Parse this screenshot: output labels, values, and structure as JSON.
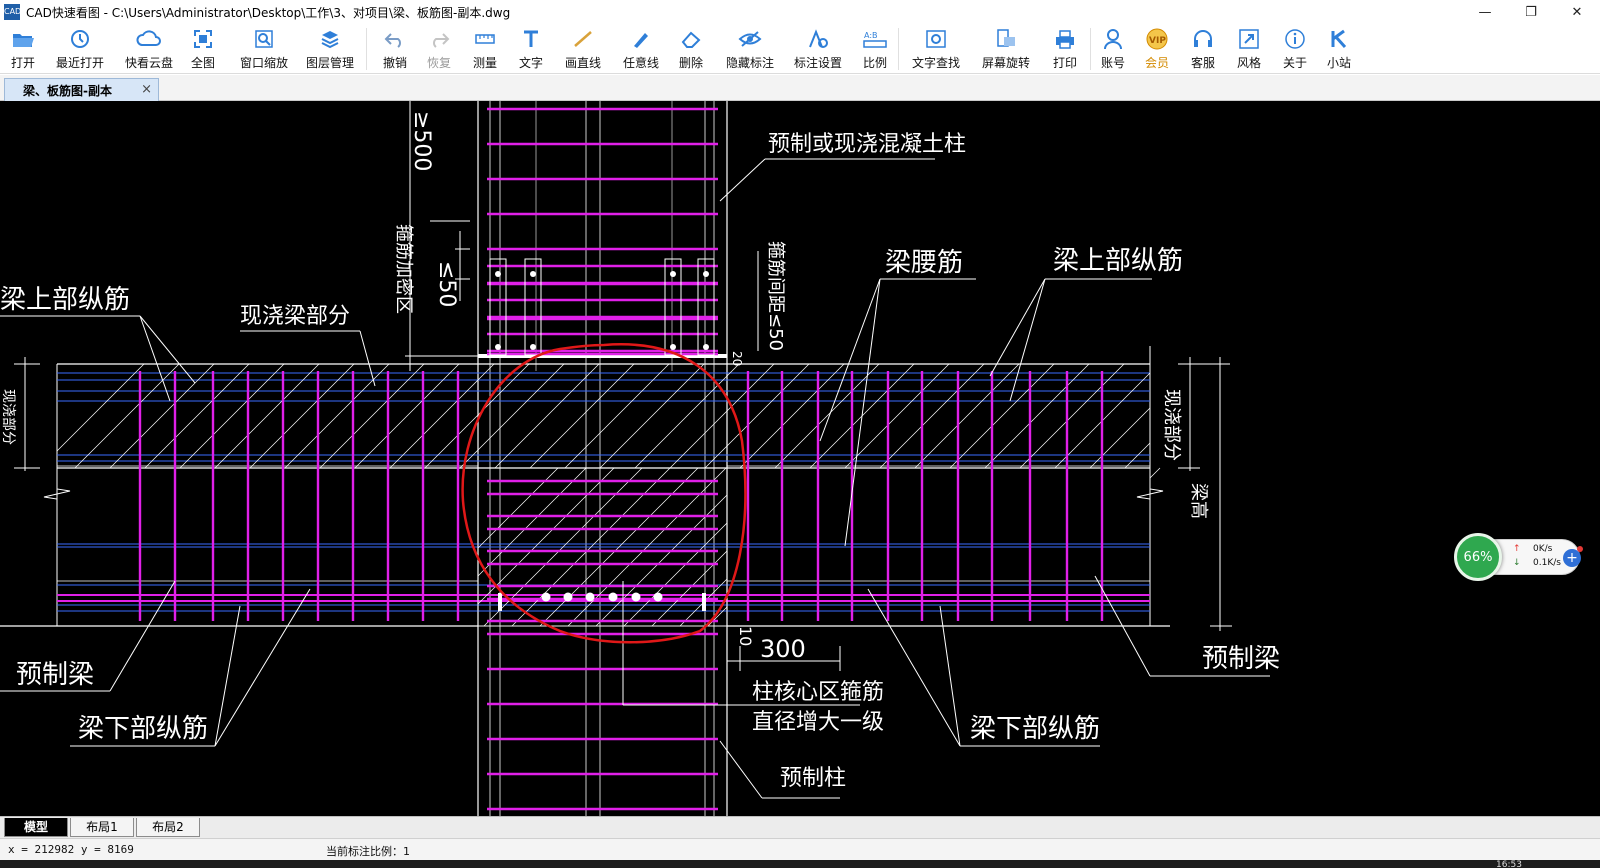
{
  "window": {
    "app_icon_text": "CAD",
    "title": "CAD快速看图 - C:\\Users\\Administrator\\Desktop\\工作\\3、对项目\\梁、板筋图-副本.dwg",
    "minimize": "—",
    "restore": "❐",
    "close": "✕"
  },
  "toolbar": {
    "items": [
      {
        "label": "打开",
        "icon": "folder-open-icon"
      },
      {
        "label": "最近打开",
        "icon": "recent-icon"
      },
      {
        "label": "快看云盘",
        "icon": "cloud-icon"
      },
      {
        "label": "全图",
        "icon": "fit-all-icon"
      },
      {
        "label": "窗口缩放",
        "icon": "zoom-window-icon"
      },
      {
        "label": "图层管理",
        "icon": "layers-icon"
      },
      {
        "label": "撤销",
        "icon": "undo-icon"
      },
      {
        "label": "恢复",
        "icon": "redo-icon"
      },
      {
        "label": "测量",
        "icon": "measure-icon"
      },
      {
        "label": "文字",
        "icon": "text-icon"
      },
      {
        "label": "画直线",
        "icon": "line-icon"
      },
      {
        "label": "任意线",
        "icon": "freehand-icon"
      },
      {
        "label": "删除",
        "icon": "eraser-icon"
      },
      {
        "label": "隐藏标注",
        "icon": "eye-hide-icon"
      },
      {
        "label": "标注设置",
        "icon": "annotation-settings-icon"
      },
      {
        "label": "比例",
        "icon": "scale-icon"
      },
      {
        "label": "文字查找",
        "icon": "text-search-icon"
      },
      {
        "label": "屏幕旋转",
        "icon": "rotate-screen-icon"
      },
      {
        "label": "打印",
        "icon": "printer-icon"
      },
      {
        "label": "账号",
        "icon": "account-icon"
      },
      {
        "label": "会员",
        "icon": "vip-icon"
      },
      {
        "label": "客服",
        "icon": "headset-icon"
      },
      {
        "label": "风格",
        "icon": "style-icon"
      },
      {
        "label": "关于",
        "icon": "info-icon"
      },
      {
        "label": "小站",
        "icon": "site-icon"
      }
    ],
    "vip_badge": "VIP"
  },
  "doc_tab": {
    "label": "梁、板筋图-副本",
    "close": "×"
  },
  "drawing": {
    "labels": {
      "precast_or_cast_column": "预制或现浇混凝土柱",
      "stirrup_dense_zone": "箍筋加密区",
      "dim_500": "≥500",
      "dim_50": "≤50",
      "stirrup_spacing": "箍筋间距≤50",
      "beam_waist_bar": "梁腰筋",
      "top_long_bar_right": "梁上部纵筋",
      "top_long_bar_left": "梁上部纵筋",
      "cast_beam_part": "现浇梁部分",
      "cast_part_left": "现浇部分",
      "cast_part_right": "现浇部分",
      "beam_height": "梁高",
      "dim_20": "20",
      "dim_10": "10",
      "dim_300": "300",
      "core_stirrup": "柱核心区箍筋",
      "diameter_increase": "直径增大一级",
      "precast_beam_left": "预制梁",
      "precast_beam_right": "预制梁",
      "bottom_long_bar_left": "梁下部纵筋",
      "bottom_long_bar_right": "梁下部纵筋",
      "precast_column": "预制柱"
    },
    "colors": {
      "bar_magenta": "#e020e8",
      "line_white": "#ffffff",
      "line_blue": "#3a6cff",
      "markup_red": "#e01818"
    }
  },
  "layout_tabs": [
    {
      "label": "模型"
    },
    {
      "label": "布局1"
    },
    {
      "label": "布局2"
    }
  ],
  "status": {
    "coords": "x = 212982  y = 8169",
    "scale": "当前标注比例：1",
    "clock": "16:53"
  },
  "net_widget": {
    "percent": "66%",
    "up": "0K/s",
    "down": "0.1K/s",
    "up_arrow": "↑",
    "down_arrow": "↓",
    "plus": "+"
  }
}
